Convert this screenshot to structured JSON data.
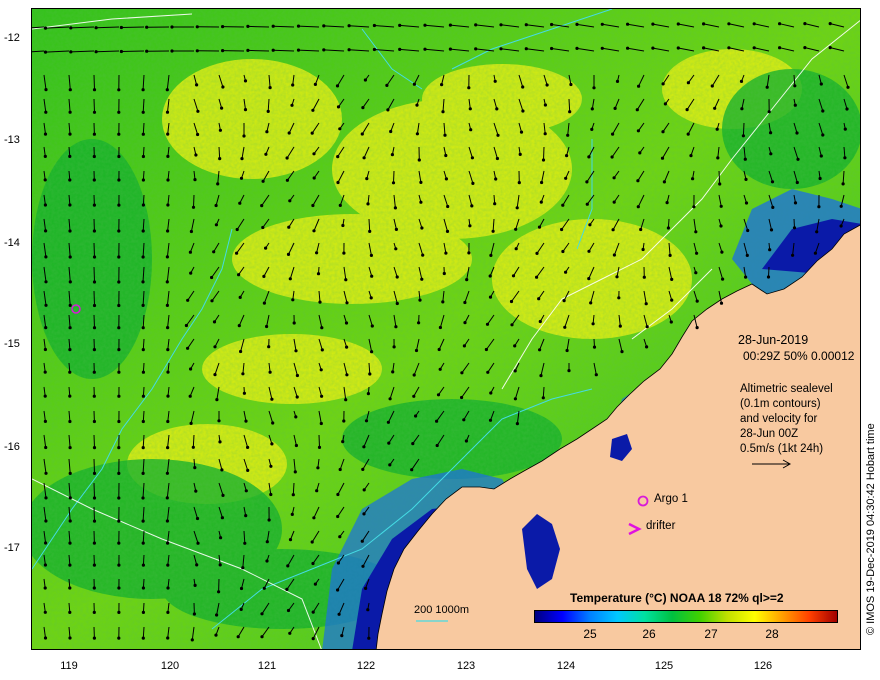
{
  "map": {
    "date": "28-Jun-2019",
    "time_info": "00:29Z  50% 0.00012",
    "altimetry_lines": [
      "Altimetric sealevel",
      "(0.1m contours)",
      "and velocity for",
      "28-Jun 00Z",
      "0.5m/s (1kt 24h)"
    ],
    "argo_label": "Argo 1",
    "drifter_label": "drifter",
    "depth_contours_label": "200  1000m",
    "credit": "© IMOS 19-Dec-2019 04:30:42 Hobart time",
    "colors": {
      "land": "#f8c9a0",
      "argo": "#d81bd8",
      "drifter": "#e011e0",
      "depth_contour": "#3ad4e0"
    }
  },
  "axes": {
    "y_ticks": [
      "-12",
      "-13",
      "-14",
      "-15",
      "-16",
      "-17"
    ],
    "x_ticks": [
      "119",
      "120",
      "121",
      "122",
      "123",
      "124",
      "125",
      "126"
    ]
  },
  "colorbar": {
    "title": "Temperature (°C) NOAA 18 72% ql>=2",
    "ticks": [
      "25",
      "26",
      "27",
      "28"
    ],
    "colors": [
      "#00007f",
      "#0000ff",
      "#0080ff",
      "#00c8ff",
      "#00e0a0",
      "#00c040",
      "#40d000",
      "#c0e000",
      "#ffff00",
      "#ffa000",
      "#ff4000",
      "#a00000"
    ]
  }
}
